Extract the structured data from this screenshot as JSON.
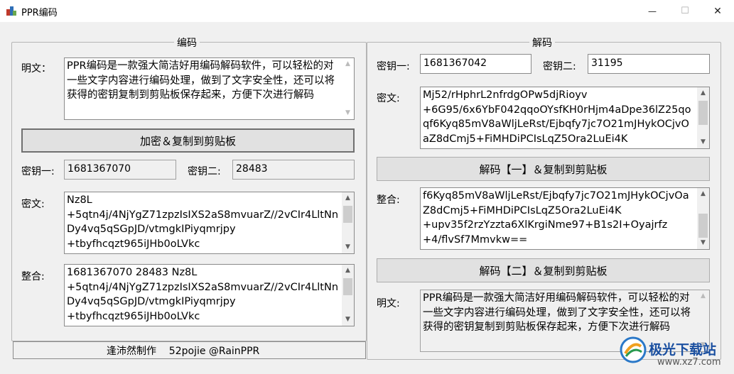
{
  "window": {
    "title": "PPR编码",
    "minimize": "—",
    "maximize": "☐",
    "close": "✕"
  },
  "encode": {
    "group_title": "编码",
    "plain_label": "明文：",
    "plain_text": "PPR编码是一款强大简洁好用编码解码软件，可以轻松的对一些文字内容进行编码处理，做到了文字安全性，还可以将获得的密钥复制到剪贴板保存起来，方便下次进行解码",
    "encrypt_button": "加密＆复制到剪贴板",
    "key1_label": "密钥一:",
    "key1_value": "1681367070",
    "key2_label": "密钥二:",
    "key2_value": "28483",
    "cipher_label": "密文:",
    "cipher_text": "Nz8L\n+5qtn4j/4NjYgZ71zpzIsIXS2aS8mvuarZ//2vCIr4LltNnDy4vq5qSGpJD/vtmgkIPiyqmrjpy\n+tbyfhcqzt965iJHb0oLVkc",
    "combined_label": "整合:",
    "combined_text": "1681367070 28483 Nz8L\n+5qtn4j/4NjYgZ71zpzIsIXS2aS8mvuarZ//2vCIr4LltNnDy4vq5qSGpJD/vtmgkIPiyqmrjpy\n+tbyfhcqzt965iJHb0oLVkc",
    "footer": "逢沛然制作    52pojie @RainPPR"
  },
  "decode": {
    "group_title": "解码",
    "key1_label": "密钥一:",
    "key1_value": "1681367042",
    "key2_label": "密钥二:",
    "key2_value": "31195",
    "cipher_label": "密文:",
    "cipher_text": "Mj52/rHphrL2nfrdgOPw5djRioyv\n+6G95/6x6YbF042qqoOYsfKH0rHjm4aDpe36lZ25qoqf6Kyq85mV8aWljLeRst/Ejbqfy7jc7O21mJHykOCjvOaZ8dCmj5+FiMHDiPCIsLqZ5Ora2LuEi4K",
    "decode1_button": "解码【一】＆复制到剪贴板",
    "combined_label": "整合:",
    "combined_text": "f6Kyq85mV8aWljLeRst/Ejbqfy7jc7O21mJHykOCjvOaZ8dCmj5+FiMHDiPCIsLqZ5Ora2LuEi4K\n+upv35f2rzYzzta6XlKrgiNme97+B1s2I+Oyajrfz\n+4/flvSf7Mmvkw==",
    "decode2_button": "解码【二】＆复制到剪贴板",
    "plain_label": "明文:",
    "plain_text": "PPR编码是一款强大简洁好用编码解码软件，可以轻松的对一些文字内容进行编码处理，做到了文字安全性，还可以将获得的密钥复制到剪贴板保存起来，方便下次进行解码"
  },
  "watermark": {
    "brand": "极光下载站",
    "url": "www.xz7.com"
  },
  "icons": {
    "app_icon": "app-icon",
    "logo": "aurora-logo-icon"
  },
  "colors": {
    "window_bg": "#f0f0f0",
    "titlebar_bg": "#ffffff",
    "button_bg": "#e1e1e1",
    "watermark_blue": "#1a4fa0"
  }
}
